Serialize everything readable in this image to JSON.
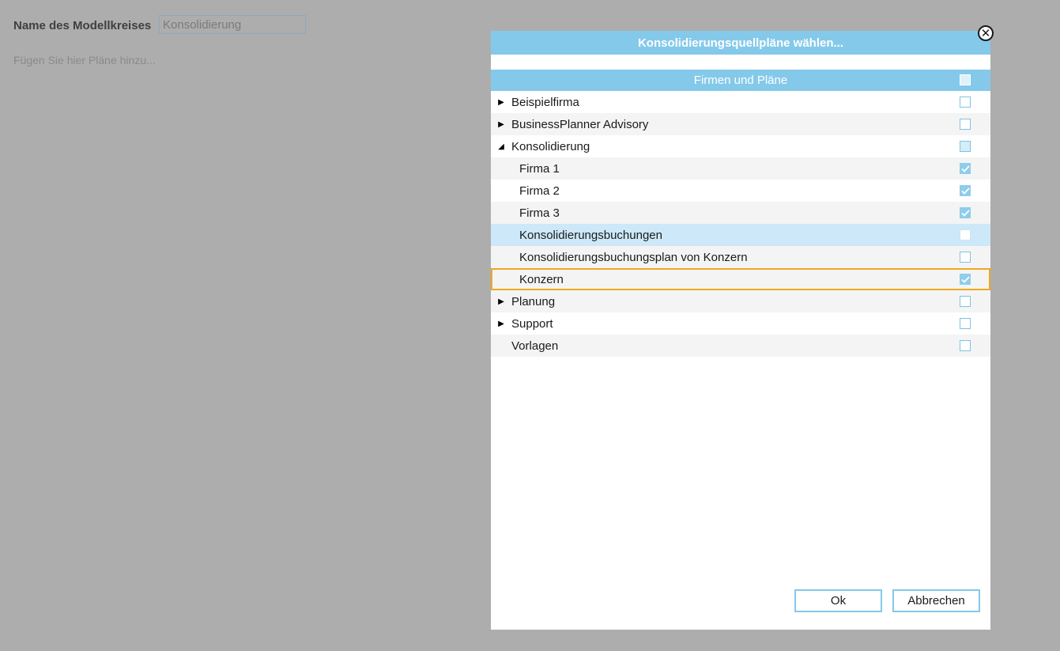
{
  "form": {
    "name_label": "Name des Modellkreises",
    "name_value": "Konsolidierung",
    "add_hint": "Fügen Sie hier Pläne hinzu..."
  },
  "dialog": {
    "title": "Konsolidierungsquellpläne wählen...",
    "close_icon": "close-circle-icon",
    "table_header": "Firmen und Pläne",
    "rows": [
      {
        "label": "Beispielfirma",
        "level": 0,
        "expander": "collapsed",
        "state": "unchecked"
      },
      {
        "label": "BusinessPlanner Advisory",
        "level": 0,
        "expander": "collapsed",
        "state": "unchecked"
      },
      {
        "label": "Konsolidierung",
        "level": 0,
        "expander": "expanded",
        "state": "partial"
      },
      {
        "label": "Firma 1",
        "level": 1,
        "expander": "none",
        "state": "checked"
      },
      {
        "label": "Firma 2",
        "level": 1,
        "expander": "none",
        "state": "checked"
      },
      {
        "label": "Firma 3",
        "level": 1,
        "expander": "none",
        "state": "checked"
      },
      {
        "label": "Konsolidierungsbuchungen",
        "level": 1,
        "expander": "none",
        "state": "disabled"
      },
      {
        "label": "Konsolidierungsbuchungsplan von Konzern",
        "level": 1,
        "expander": "none",
        "state": "unchecked"
      },
      {
        "label": "Konzern",
        "level": 1,
        "expander": "none",
        "state": "checked"
      },
      {
        "label": "Planung",
        "level": 0,
        "expander": "collapsed",
        "state": "unchecked"
      },
      {
        "label": "Support",
        "level": 0,
        "expander": "collapsed",
        "state": "unchecked"
      },
      {
        "label": "Vorlagen",
        "level": 0,
        "expander": "none",
        "state": "unchecked"
      }
    ],
    "ok_label": "Ok",
    "cancel_label": "Abbrechen"
  },
  "colors": {
    "accent": "#84c9ea",
    "overlay": "#adadad",
    "focus": "#f0a820"
  }
}
